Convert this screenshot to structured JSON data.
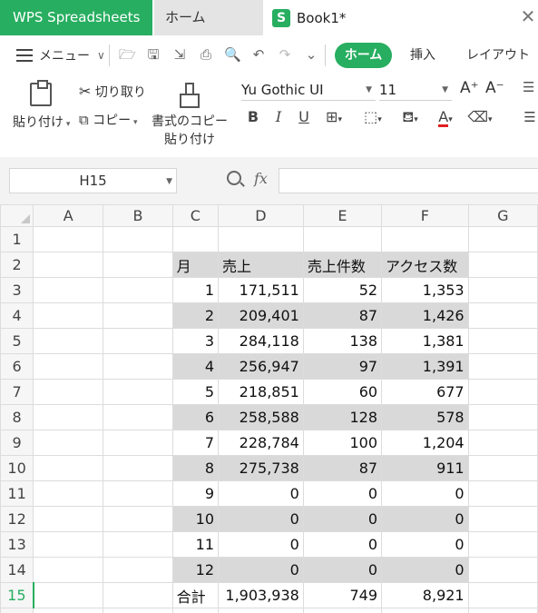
{
  "tabs": {
    "app": "WPS Spreadsheets",
    "home": "ホーム",
    "book": "Book1*",
    "book_logo": "S"
  },
  "quickbar": {
    "menu": "メニュー",
    "ribbon_tabs": [
      "ホーム",
      "挿入",
      "レイアウト"
    ]
  },
  "ribbon": {
    "paste": "貼り付け",
    "cut": "切り取り",
    "copy": "コピー",
    "format_copy_line1": "書式のコピー",
    "format_copy_line2": "貼り付け",
    "font_name": "Yu Gothic UI",
    "font_size": "11",
    "bold": "B",
    "italic": "I",
    "underline": "U",
    "font_color_glyph": "A",
    "colors": {
      "accent": "#27ae60",
      "font_color": "#e02020"
    }
  },
  "formula": {
    "cell_ref": "H15",
    "fx": "fx",
    "value": ""
  },
  "grid": {
    "columns": [
      "A",
      "B",
      "C",
      "D",
      "E",
      "F",
      "G"
    ],
    "active_row": "15",
    "header_row": {
      "row": "2",
      "c": "月",
      "d": "売上",
      "e": "売上件数",
      "f": "アクセス数"
    },
    "rows": [
      {
        "row": "3",
        "c": "1",
        "d": "171,511",
        "e": "52",
        "f": "1,353"
      },
      {
        "row": "4",
        "c": "2",
        "d": "209,401",
        "e": "87",
        "f": "1,426"
      },
      {
        "row": "5",
        "c": "3",
        "d": "284,118",
        "e": "138",
        "f": "1,381"
      },
      {
        "row": "6",
        "c": "4",
        "d": "256,947",
        "e": "97",
        "f": "1,391"
      },
      {
        "row": "7",
        "c": "5",
        "d": "218,851",
        "e": "60",
        "f": "677"
      },
      {
        "row": "8",
        "c": "6",
        "d": "258,588",
        "e": "128",
        "f": "578"
      },
      {
        "row": "9",
        "c": "7",
        "d": "228,784",
        "e": "100",
        "f": "1,204"
      },
      {
        "row": "10",
        "c": "8",
        "d": "275,738",
        "e": "87",
        "f": "911"
      },
      {
        "row": "11",
        "c": "9",
        "d": "0",
        "e": "0",
        "f": "0"
      },
      {
        "row": "12",
        "c": "10",
        "d": "0",
        "e": "0",
        "f": "0"
      },
      {
        "row": "13",
        "c": "11",
        "d": "0",
        "e": "0",
        "f": "0"
      },
      {
        "row": "14",
        "c": "12",
        "d": "0",
        "e": "0",
        "f": "0"
      }
    ],
    "total_row": {
      "row": "15",
      "c": "合計",
      "d": "1,903,938",
      "e": "749",
      "f": "8,921"
    }
  }
}
